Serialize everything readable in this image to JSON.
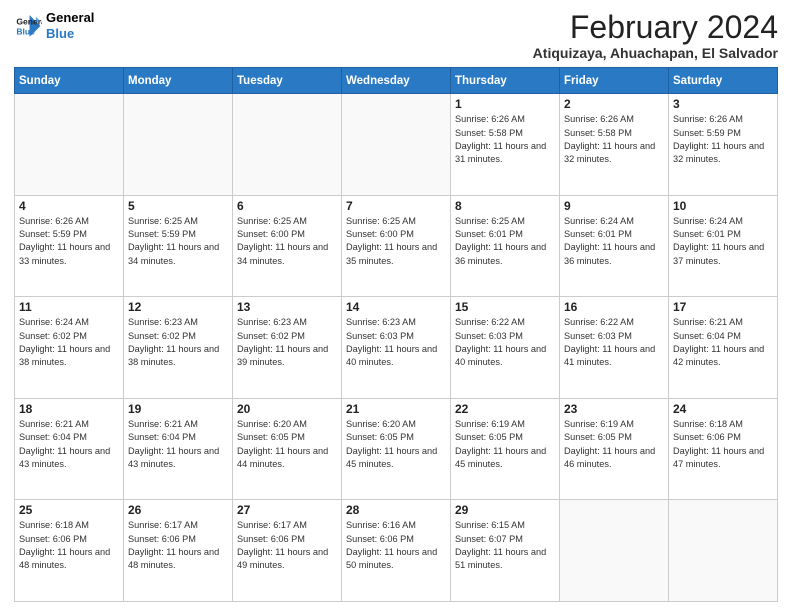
{
  "header": {
    "logo_line1": "General",
    "logo_line2": "Blue",
    "month_title": "February 2024",
    "location": "Atiquizaya, Ahuachapan, El Salvador"
  },
  "days_of_week": [
    "Sunday",
    "Monday",
    "Tuesday",
    "Wednesday",
    "Thursday",
    "Friday",
    "Saturday"
  ],
  "weeks": [
    [
      {
        "day": "",
        "info": ""
      },
      {
        "day": "",
        "info": ""
      },
      {
        "day": "",
        "info": ""
      },
      {
        "day": "",
        "info": ""
      },
      {
        "day": "1",
        "info": "Sunrise: 6:26 AM\nSunset: 5:58 PM\nDaylight: 11 hours and 31 minutes."
      },
      {
        "day": "2",
        "info": "Sunrise: 6:26 AM\nSunset: 5:58 PM\nDaylight: 11 hours and 32 minutes."
      },
      {
        "day": "3",
        "info": "Sunrise: 6:26 AM\nSunset: 5:59 PM\nDaylight: 11 hours and 32 minutes."
      }
    ],
    [
      {
        "day": "4",
        "info": "Sunrise: 6:26 AM\nSunset: 5:59 PM\nDaylight: 11 hours and 33 minutes."
      },
      {
        "day": "5",
        "info": "Sunrise: 6:25 AM\nSunset: 5:59 PM\nDaylight: 11 hours and 34 minutes."
      },
      {
        "day": "6",
        "info": "Sunrise: 6:25 AM\nSunset: 6:00 PM\nDaylight: 11 hours and 34 minutes."
      },
      {
        "day": "7",
        "info": "Sunrise: 6:25 AM\nSunset: 6:00 PM\nDaylight: 11 hours and 35 minutes."
      },
      {
        "day": "8",
        "info": "Sunrise: 6:25 AM\nSunset: 6:01 PM\nDaylight: 11 hours and 36 minutes."
      },
      {
        "day": "9",
        "info": "Sunrise: 6:24 AM\nSunset: 6:01 PM\nDaylight: 11 hours and 36 minutes."
      },
      {
        "day": "10",
        "info": "Sunrise: 6:24 AM\nSunset: 6:01 PM\nDaylight: 11 hours and 37 minutes."
      }
    ],
    [
      {
        "day": "11",
        "info": "Sunrise: 6:24 AM\nSunset: 6:02 PM\nDaylight: 11 hours and 38 minutes."
      },
      {
        "day": "12",
        "info": "Sunrise: 6:23 AM\nSunset: 6:02 PM\nDaylight: 11 hours and 38 minutes."
      },
      {
        "day": "13",
        "info": "Sunrise: 6:23 AM\nSunset: 6:02 PM\nDaylight: 11 hours and 39 minutes."
      },
      {
        "day": "14",
        "info": "Sunrise: 6:23 AM\nSunset: 6:03 PM\nDaylight: 11 hours and 40 minutes."
      },
      {
        "day": "15",
        "info": "Sunrise: 6:22 AM\nSunset: 6:03 PM\nDaylight: 11 hours and 40 minutes."
      },
      {
        "day": "16",
        "info": "Sunrise: 6:22 AM\nSunset: 6:03 PM\nDaylight: 11 hours and 41 minutes."
      },
      {
        "day": "17",
        "info": "Sunrise: 6:21 AM\nSunset: 6:04 PM\nDaylight: 11 hours and 42 minutes."
      }
    ],
    [
      {
        "day": "18",
        "info": "Sunrise: 6:21 AM\nSunset: 6:04 PM\nDaylight: 11 hours and 43 minutes."
      },
      {
        "day": "19",
        "info": "Sunrise: 6:21 AM\nSunset: 6:04 PM\nDaylight: 11 hours and 43 minutes."
      },
      {
        "day": "20",
        "info": "Sunrise: 6:20 AM\nSunset: 6:05 PM\nDaylight: 11 hours and 44 minutes."
      },
      {
        "day": "21",
        "info": "Sunrise: 6:20 AM\nSunset: 6:05 PM\nDaylight: 11 hours and 45 minutes."
      },
      {
        "day": "22",
        "info": "Sunrise: 6:19 AM\nSunset: 6:05 PM\nDaylight: 11 hours and 45 minutes."
      },
      {
        "day": "23",
        "info": "Sunrise: 6:19 AM\nSunset: 6:05 PM\nDaylight: 11 hours and 46 minutes."
      },
      {
        "day": "24",
        "info": "Sunrise: 6:18 AM\nSunset: 6:06 PM\nDaylight: 11 hours and 47 minutes."
      }
    ],
    [
      {
        "day": "25",
        "info": "Sunrise: 6:18 AM\nSunset: 6:06 PM\nDaylight: 11 hours and 48 minutes."
      },
      {
        "day": "26",
        "info": "Sunrise: 6:17 AM\nSunset: 6:06 PM\nDaylight: 11 hours and 48 minutes."
      },
      {
        "day": "27",
        "info": "Sunrise: 6:17 AM\nSunset: 6:06 PM\nDaylight: 11 hours and 49 minutes."
      },
      {
        "day": "28",
        "info": "Sunrise: 6:16 AM\nSunset: 6:06 PM\nDaylight: 11 hours and 50 minutes."
      },
      {
        "day": "29",
        "info": "Sunrise: 6:15 AM\nSunset: 6:07 PM\nDaylight: 11 hours and 51 minutes."
      },
      {
        "day": "",
        "info": ""
      },
      {
        "day": "",
        "info": ""
      }
    ]
  ]
}
